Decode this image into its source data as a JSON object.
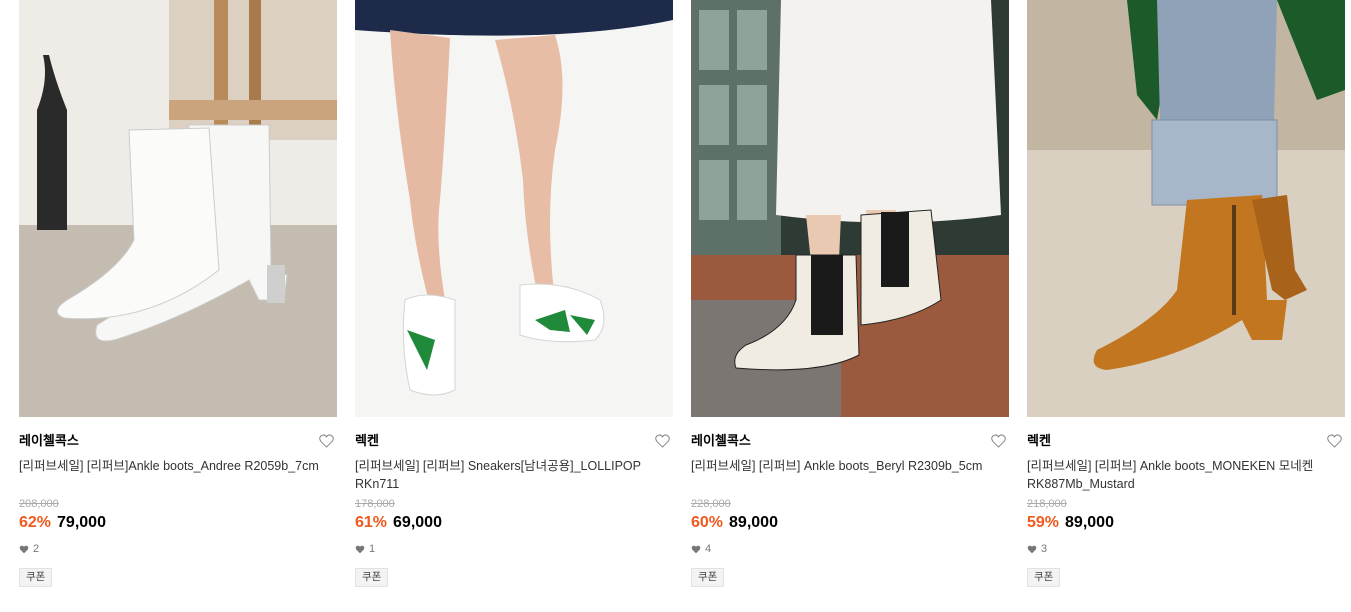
{
  "products": [
    {
      "brand": "레이첼콕스",
      "name": "[리퍼브세일] [리퍼브]Ankle boots_Andree R2059b_7cm",
      "original_price": "208,000",
      "discount": "62%",
      "price": "79,000",
      "likes": "2",
      "badge": "쿠폰",
      "image": "white-ankle-boots"
    },
    {
      "brand": "렉켄",
      "name": "[리퍼브세일] [리퍼브] Sneakers[남녀공용]_LOLLIPOP RKn711",
      "original_price": "178,000",
      "discount": "61%",
      "price": "69,000",
      "likes": "1",
      "badge": "쿠폰",
      "image": "white-green-sneakers"
    },
    {
      "brand": "레이첼콕스",
      "name": "[리퍼브세일] [리퍼브] Ankle boots_Beryl R2309b_5cm",
      "original_price": "228,000",
      "discount": "60%",
      "price": "89,000",
      "likes": "4",
      "badge": "쿠폰",
      "image": "cream-chelsea-boots"
    },
    {
      "brand": "렉켄",
      "name": "[리퍼브세일] [리퍼브] Ankle boots_MONEKEN 모네켄 RK887Mb_Mustard",
      "original_price": "218,000",
      "discount": "59%",
      "price": "89,000",
      "likes": "3",
      "badge": "쿠폰",
      "image": "mustard-ankle-boots"
    }
  ],
  "colors": {
    "discount": "#f05a1e",
    "brand": "#000000",
    "muted": "#aaaaaa"
  }
}
